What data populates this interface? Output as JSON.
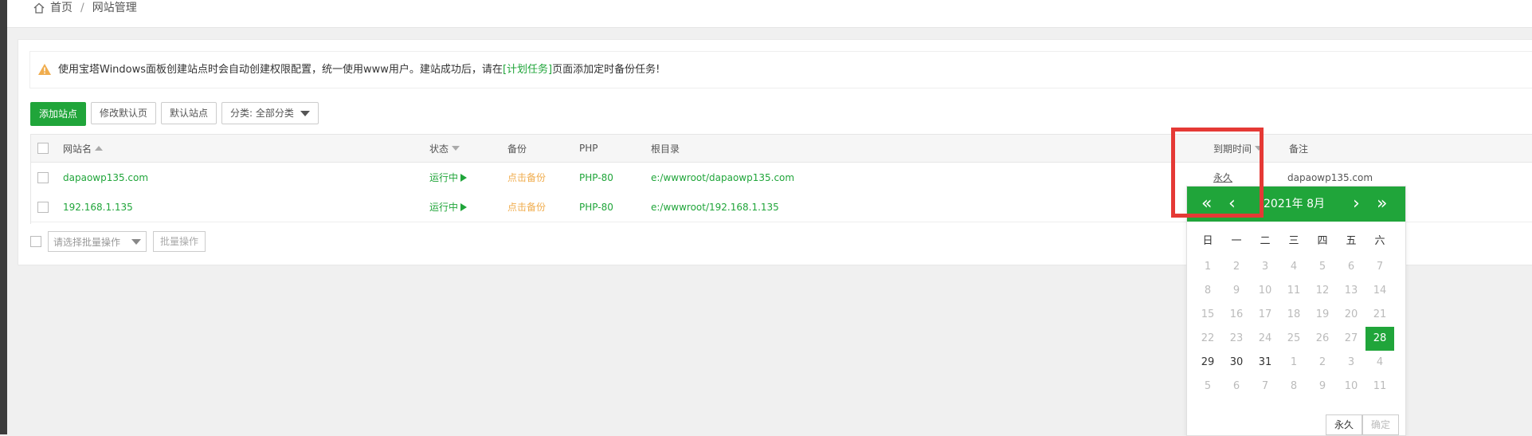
{
  "breadcrumb": {
    "home": "首页",
    "separator": "/",
    "current": "网站管理"
  },
  "notice": {
    "text_before": "使用宝塔Windows面板创建站点时会自动创建权限配置，统一使用www用户。建站成功后，请在",
    "link": "[计划任务]",
    "text_after": "页面添加定时备份任务!"
  },
  "toolbar": {
    "add_site": "添加站点",
    "edit_default_page": "修改默认页",
    "default_site": "默认站点",
    "category_select": "分类: 全部分类"
  },
  "table": {
    "headers": {
      "name": "网站名",
      "status": "状态",
      "backup": "备份",
      "php": "PHP",
      "root": "根目录",
      "expire": "到期时间",
      "note": "备注"
    },
    "rows": [
      {
        "name": "dapaowp135.com",
        "status": "运行中",
        "backup": "点击备份",
        "php": "PHP-80",
        "root": "e:/wwwroot/dapaowp135.com",
        "expire": "永久",
        "note": "dapaowp135.com"
      },
      {
        "name": "192.168.1.135",
        "status": "运行中",
        "backup": "点击备份",
        "php": "PHP-80",
        "root": "e:/wwwroot/192.168.1.135",
        "expire": "",
        "note": ""
      }
    ]
  },
  "batch": {
    "select_placeholder": "请选择批量操作",
    "button": "批量操作"
  },
  "calendar": {
    "title": "2021年  8月",
    "nav": {
      "prev_year": "«",
      "prev_month": "‹",
      "next_month": "›",
      "next_year": "»"
    },
    "weekdays": [
      "日",
      "一",
      "二",
      "三",
      "四",
      "五",
      "六"
    ],
    "days": [
      {
        "d": "1",
        "s": "dim"
      },
      {
        "d": "2",
        "s": "dim"
      },
      {
        "d": "3",
        "s": "dim"
      },
      {
        "d": "4",
        "s": "dim"
      },
      {
        "d": "5",
        "s": "dim"
      },
      {
        "d": "6",
        "s": "dim"
      },
      {
        "d": "7",
        "s": "dim"
      },
      {
        "d": "8",
        "s": "dim"
      },
      {
        "d": "9",
        "s": "dim"
      },
      {
        "d": "10",
        "s": "dim"
      },
      {
        "d": "11",
        "s": "dim"
      },
      {
        "d": "12",
        "s": "dim"
      },
      {
        "d": "13",
        "s": "dim"
      },
      {
        "d": "14",
        "s": "dim"
      },
      {
        "d": "15",
        "s": "dim"
      },
      {
        "d": "16",
        "s": "dim"
      },
      {
        "d": "17",
        "s": "dim"
      },
      {
        "d": "18",
        "s": "dim"
      },
      {
        "d": "19",
        "s": "dim"
      },
      {
        "d": "20",
        "s": "dim"
      },
      {
        "d": "21",
        "s": "dim"
      },
      {
        "d": "22",
        "s": "dim"
      },
      {
        "d": "23",
        "s": "dim"
      },
      {
        "d": "24",
        "s": "dim"
      },
      {
        "d": "25",
        "s": "dim"
      },
      {
        "d": "26",
        "s": "dim"
      },
      {
        "d": "27",
        "s": "dim"
      },
      {
        "d": "28",
        "s": "sel"
      },
      {
        "d": "29",
        "s": "cur"
      },
      {
        "d": "30",
        "s": "cur"
      },
      {
        "d": "31",
        "s": "cur"
      },
      {
        "d": "1",
        "s": "dim"
      },
      {
        "d": "2",
        "s": "dim"
      },
      {
        "d": "3",
        "s": "dim"
      },
      {
        "d": "4",
        "s": "dim"
      },
      {
        "d": "5",
        "s": "dim"
      },
      {
        "d": "6",
        "s": "dim"
      },
      {
        "d": "7",
        "s": "dim"
      },
      {
        "d": "8",
        "s": "dim"
      },
      {
        "d": "9",
        "s": "dim"
      },
      {
        "d": "10",
        "s": "dim"
      },
      {
        "d": "11",
        "s": "dim"
      }
    ],
    "permanent_button": "永久",
    "confirm_button": "确定"
  },
  "colors": {
    "accent": "#20a53a",
    "warning": "#f0ad4e",
    "highlight": "#e53935"
  }
}
